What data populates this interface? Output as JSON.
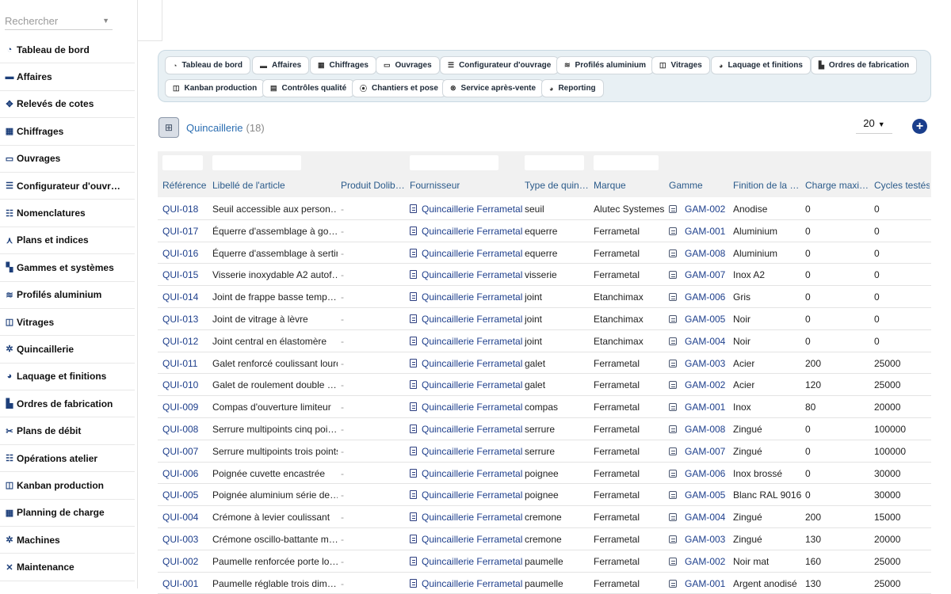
{
  "sidebar": {
    "search_placeholder": "Rechercher",
    "items": [
      {
        "label": "Tableau de bord",
        "icon": "dashboard-icon"
      },
      {
        "label": "Affaires",
        "icon": "briefcase-icon"
      },
      {
        "label": "Relevés de cotes",
        "icon": "move-icon"
      },
      {
        "label": "Chiffrages",
        "icon": "calculator-icon"
      },
      {
        "label": "Ouvrages",
        "icon": "window-icon"
      },
      {
        "label": "Configurateur d'ouvr…",
        "icon": "sliders-icon"
      },
      {
        "label": "Nomenclatures",
        "icon": "list-icon"
      },
      {
        "label": "Plans et indices",
        "icon": "compass-icon"
      },
      {
        "label": "Gammes et systèmes",
        "icon": "grid-icon"
      },
      {
        "label": "Profilés aluminium",
        "icon": "layers-icon"
      },
      {
        "label": "Vitrages",
        "icon": "glass-icon"
      },
      {
        "label": "Quincaillerie",
        "icon": "cogs-icon"
      },
      {
        "label": "Laquage et finitions",
        "icon": "palette-icon"
      },
      {
        "label": "Ordres de fabrication",
        "icon": "factory-icon"
      },
      {
        "label": "Plans de débit",
        "icon": "scissors-icon"
      },
      {
        "label": "Opérations atelier",
        "icon": "tasks-icon"
      },
      {
        "label": "Kanban production",
        "icon": "kanban-icon"
      },
      {
        "label": "Planning de charge",
        "icon": "calendar-icon"
      },
      {
        "label": "Machines",
        "icon": "gears-icon"
      },
      {
        "label": "Maintenance",
        "icon": "tools-icon"
      }
    ]
  },
  "tabs": [
    {
      "label": "Tableau de bord",
      "icon": "dashboard-icon"
    },
    {
      "label": "Affaires",
      "icon": "briefcase-icon"
    },
    {
      "label": "Chiffrages",
      "icon": "calculator-icon"
    },
    {
      "label": "Ouvrages",
      "icon": "window-icon"
    },
    {
      "label": "Configurateur d'ouvrage",
      "icon": "sliders-icon"
    },
    {
      "label": "Profilés aluminium",
      "icon": "layers-icon"
    },
    {
      "label": "Vitrages",
      "icon": "glass-icon"
    },
    {
      "label": "Laquage et finitions",
      "icon": "palette-icon"
    },
    {
      "label": "Ordres de fabrication",
      "icon": "factory-icon"
    },
    {
      "label": "Kanban production",
      "icon": "kanban-icon"
    },
    {
      "label": "Contrôles qualité",
      "icon": "clipboard-icon"
    },
    {
      "label": "Chantiers et pose",
      "icon": "map-pin-icon"
    },
    {
      "label": "Service après-vente",
      "icon": "support-icon"
    },
    {
      "label": "Reporting",
      "icon": "pie-chart-icon"
    }
  ],
  "page": {
    "title": "Quincaillerie",
    "count": "(18)",
    "page_size": "20"
  },
  "columns": [
    "Référence",
    "Libellé de l'article",
    "Produit Dolib…",
    "Fournisseur",
    "Type de quin…",
    "Marque",
    "Gamme",
    "Finition de la …",
    "Charge maxi…",
    "Cycles testés"
  ],
  "rows": [
    {
      "ref": "QUI-018",
      "label": "Seuil accessible aux person…",
      "product": "-",
      "supplier": "Quincaillerie Ferrametal",
      "type": "seuil",
      "brand": "Alutec Systemes",
      "range": "GAM-002",
      "finish": "Anodise",
      "charge": "0",
      "cycles": "0"
    },
    {
      "ref": "QUI-017",
      "label": "Équerre d'assemblage à go…",
      "product": "-",
      "supplier": "Quincaillerie Ferrametal",
      "type": "equerre",
      "brand": "Ferrametal",
      "range": "GAM-001",
      "finish": "Aluminium",
      "charge": "0",
      "cycles": "0"
    },
    {
      "ref": "QUI-016",
      "label": "Équerre d'assemblage à sertir",
      "product": "-",
      "supplier": "Quincaillerie Ferrametal",
      "type": "equerre",
      "brand": "Ferrametal",
      "range": "GAM-008",
      "finish": "Aluminium",
      "charge": "0",
      "cycles": "0"
    },
    {
      "ref": "QUI-015",
      "label": "Visserie inoxydable A2 autof…",
      "product": "-",
      "supplier": "Quincaillerie Ferrametal",
      "type": "visserie",
      "brand": "Ferrametal",
      "range": "GAM-007",
      "finish": "Inox A2",
      "charge": "0",
      "cycles": "0"
    },
    {
      "ref": "QUI-014",
      "label": "Joint de frappe basse temp…",
      "product": "-",
      "supplier": "Quincaillerie Ferrametal",
      "type": "joint",
      "brand": "Etanchimax",
      "range": "GAM-006",
      "finish": "Gris",
      "charge": "0",
      "cycles": "0"
    },
    {
      "ref": "QUI-013",
      "label": "Joint de vitrage à lèvre",
      "product": "-",
      "supplier": "Quincaillerie Ferrametal",
      "type": "joint",
      "brand": "Etanchimax",
      "range": "GAM-005",
      "finish": "Noir",
      "charge": "0",
      "cycles": "0"
    },
    {
      "ref": "QUI-012",
      "label": "Joint central en élastomère",
      "product": "-",
      "supplier": "Quincaillerie Ferrametal",
      "type": "joint",
      "brand": "Etanchimax",
      "range": "GAM-004",
      "finish": "Noir",
      "charge": "0",
      "cycles": "0"
    },
    {
      "ref": "QUI-011",
      "label": "Galet renforcé coulissant lourd",
      "product": "-",
      "supplier": "Quincaillerie Ferrametal",
      "type": "galet",
      "brand": "Ferrametal",
      "range": "GAM-003",
      "finish": "Acier",
      "charge": "200",
      "cycles": "25000"
    },
    {
      "ref": "QUI-010",
      "label": "Galet de roulement double …",
      "product": "-",
      "supplier": "Quincaillerie Ferrametal",
      "type": "galet",
      "brand": "Ferrametal",
      "range": "GAM-002",
      "finish": "Acier",
      "charge": "120",
      "cycles": "25000"
    },
    {
      "ref": "QUI-009",
      "label": "Compas d'ouverture limiteur",
      "product": "-",
      "supplier": "Quincaillerie Ferrametal",
      "type": "compas",
      "brand": "Ferrametal",
      "range": "GAM-001",
      "finish": "Inox",
      "charge": "80",
      "cycles": "20000"
    },
    {
      "ref": "QUI-008",
      "label": "Serrure multipoints cinq poi…",
      "product": "-",
      "supplier": "Quincaillerie Ferrametal",
      "type": "serrure",
      "brand": "Ferrametal",
      "range": "GAM-008",
      "finish": "Zingué",
      "charge": "0",
      "cycles": "100000"
    },
    {
      "ref": "QUI-007",
      "label": "Serrure multipoints trois points",
      "product": "-",
      "supplier": "Quincaillerie Ferrametal",
      "type": "serrure",
      "brand": "Ferrametal",
      "range": "GAM-007",
      "finish": "Zingué",
      "charge": "0",
      "cycles": "100000"
    },
    {
      "ref": "QUI-006",
      "label": "Poignée cuvette encastrée",
      "product": "-",
      "supplier": "Quincaillerie Ferrametal",
      "type": "poignee",
      "brand": "Ferrametal",
      "range": "GAM-006",
      "finish": "Inox brossé",
      "charge": "0",
      "cycles": "30000"
    },
    {
      "ref": "QUI-005",
      "label": "Poignée aluminium série de…",
      "product": "-",
      "supplier": "Quincaillerie Ferrametal",
      "type": "poignee",
      "brand": "Ferrametal",
      "range": "GAM-005",
      "finish": "Blanc RAL 9016",
      "charge": "0",
      "cycles": "30000"
    },
    {
      "ref": "QUI-004",
      "label": "Crémone à levier coulissant",
      "product": "-",
      "supplier": "Quincaillerie Ferrametal",
      "type": "cremone",
      "brand": "Ferrametal",
      "range": "GAM-004",
      "finish": "Zingué",
      "charge": "200",
      "cycles": "15000"
    },
    {
      "ref": "QUI-003",
      "label": "Crémone oscillo-battante m…",
      "product": "-",
      "supplier": "Quincaillerie Ferrametal",
      "type": "cremone",
      "brand": "Ferrametal",
      "range": "GAM-003",
      "finish": "Zingué",
      "charge": "130",
      "cycles": "20000"
    },
    {
      "ref": "QUI-002",
      "label": "Paumelle renforcée porte lo…",
      "product": "-",
      "supplier": "Quincaillerie Ferrametal",
      "type": "paumelle",
      "brand": "Ferrametal",
      "range": "GAM-002",
      "finish": "Noir mat",
      "charge": "160",
      "cycles": "25000"
    },
    {
      "ref": "QUI-001",
      "label": "Paumelle réglable trois dim…",
      "product": "-",
      "supplier": "Quincaillerie Ferrametal",
      "type": "paumelle",
      "brand": "Ferrametal",
      "range": "GAM-001",
      "finish": "Argent anodisé",
      "charge": "130",
      "cycles": "25000"
    }
  ],
  "colors": {
    "accent": "#1a3e8c",
    "link": "#1e3f8c",
    "tabs_bg": "#e8f0f4"
  }
}
